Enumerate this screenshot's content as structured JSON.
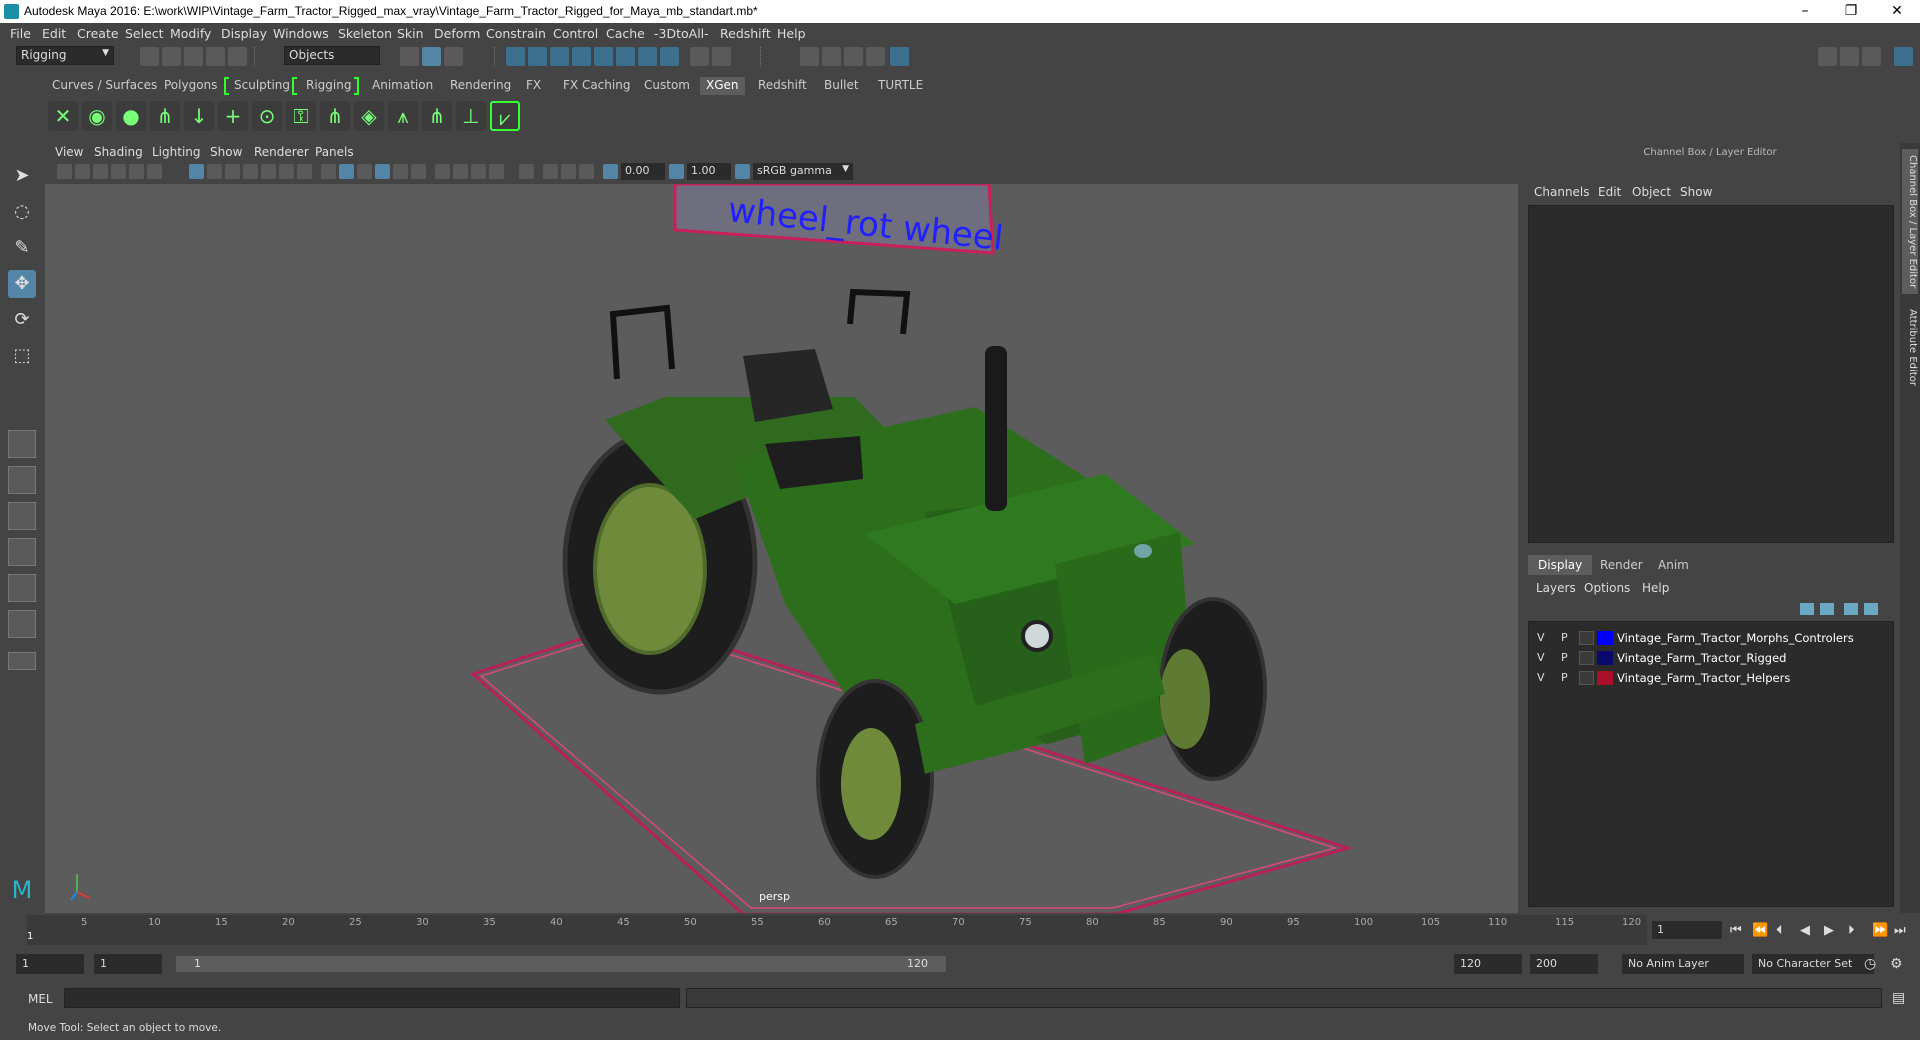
{
  "window": {
    "title": "Autodesk Maya 2016: E:\\work\\WIP\\Vintage_Farm_Tractor_Rigged_max_vray\\Vintage_Farm_Tractor_Rigged_for_Maya_mb_standart.mb*",
    "minimize": "–",
    "restore": "❐",
    "close": "✕"
  },
  "menu": [
    "File",
    "Edit",
    "Create",
    "Select",
    "Modify",
    "Display",
    "Windows",
    "Skeleton",
    "Skin",
    "Deform",
    "Constrain",
    "Control",
    "Cache",
    "-3DtoAll-",
    "Redshift",
    "Help"
  ],
  "toolbar": {
    "mode": "Rigging",
    "select_mode": "Objects"
  },
  "shelf_tabs": [
    "Curves / Surfaces",
    "Polygons",
    "Sculpting",
    "Rigging",
    "Animation",
    "Rendering",
    "FX",
    "FX Caching",
    "Custom",
    "XGen",
    "Redshift",
    "Bullet",
    "TURTLE"
  ],
  "shelf_active": "XGen",
  "viewport": {
    "menu": [
      "View",
      "Shading",
      "Lighting",
      "Show",
      "Renderer",
      "Panels"
    ],
    "exposure": "0.00",
    "gamma": "1.00",
    "colorspace": "sRGB gamma",
    "camera": "persp",
    "scene_text": "wheel_rot wheel"
  },
  "channel_box": {
    "title": "Channel Box / Layer Editor",
    "menu": [
      "Channels",
      "Edit",
      "Object",
      "Show"
    ],
    "tabs": [
      "Display",
      "Render",
      "Anim"
    ],
    "active_tab": "Display",
    "layer_menu": [
      "Layers",
      "Options",
      "Help"
    ],
    "layers": [
      {
        "v": "V",
        "p": "P",
        "name": "Vintage_Farm_Tractor_Morphs_Controlers",
        "color": "#0000ff"
      },
      {
        "v": "V",
        "p": "P",
        "name": "Vintage_Farm_Tractor_Rigged",
        "color": "#0a0a6e"
      },
      {
        "v": "V",
        "p": "P",
        "name": "Vintage_Farm_Tractor_Helpers",
        "color": "#a8102c"
      }
    ]
  },
  "side_tabs": [
    "Channel Box / Layer Editor",
    "Attribute Editor"
  ],
  "timeline": {
    "ticks": [
      "1",
      "5",
      "10",
      "15",
      "20",
      "25",
      "30",
      "35",
      "40",
      "45",
      "50",
      "55",
      "60",
      "65",
      "70",
      "75",
      "80",
      "85",
      "90",
      "95",
      "100",
      "105",
      "110",
      "115",
      "120"
    ],
    "current_frame": "1"
  },
  "range": {
    "start": "1",
    "playback_start": "1",
    "slider_start": "1",
    "slider_end": "120",
    "playback_end": "120",
    "end": "200",
    "anim_layer": "No Anim Layer",
    "character_set": "No Character Set"
  },
  "mel": {
    "label": "MEL"
  },
  "status": {
    "text": "Move Tool: Select an object to move."
  }
}
